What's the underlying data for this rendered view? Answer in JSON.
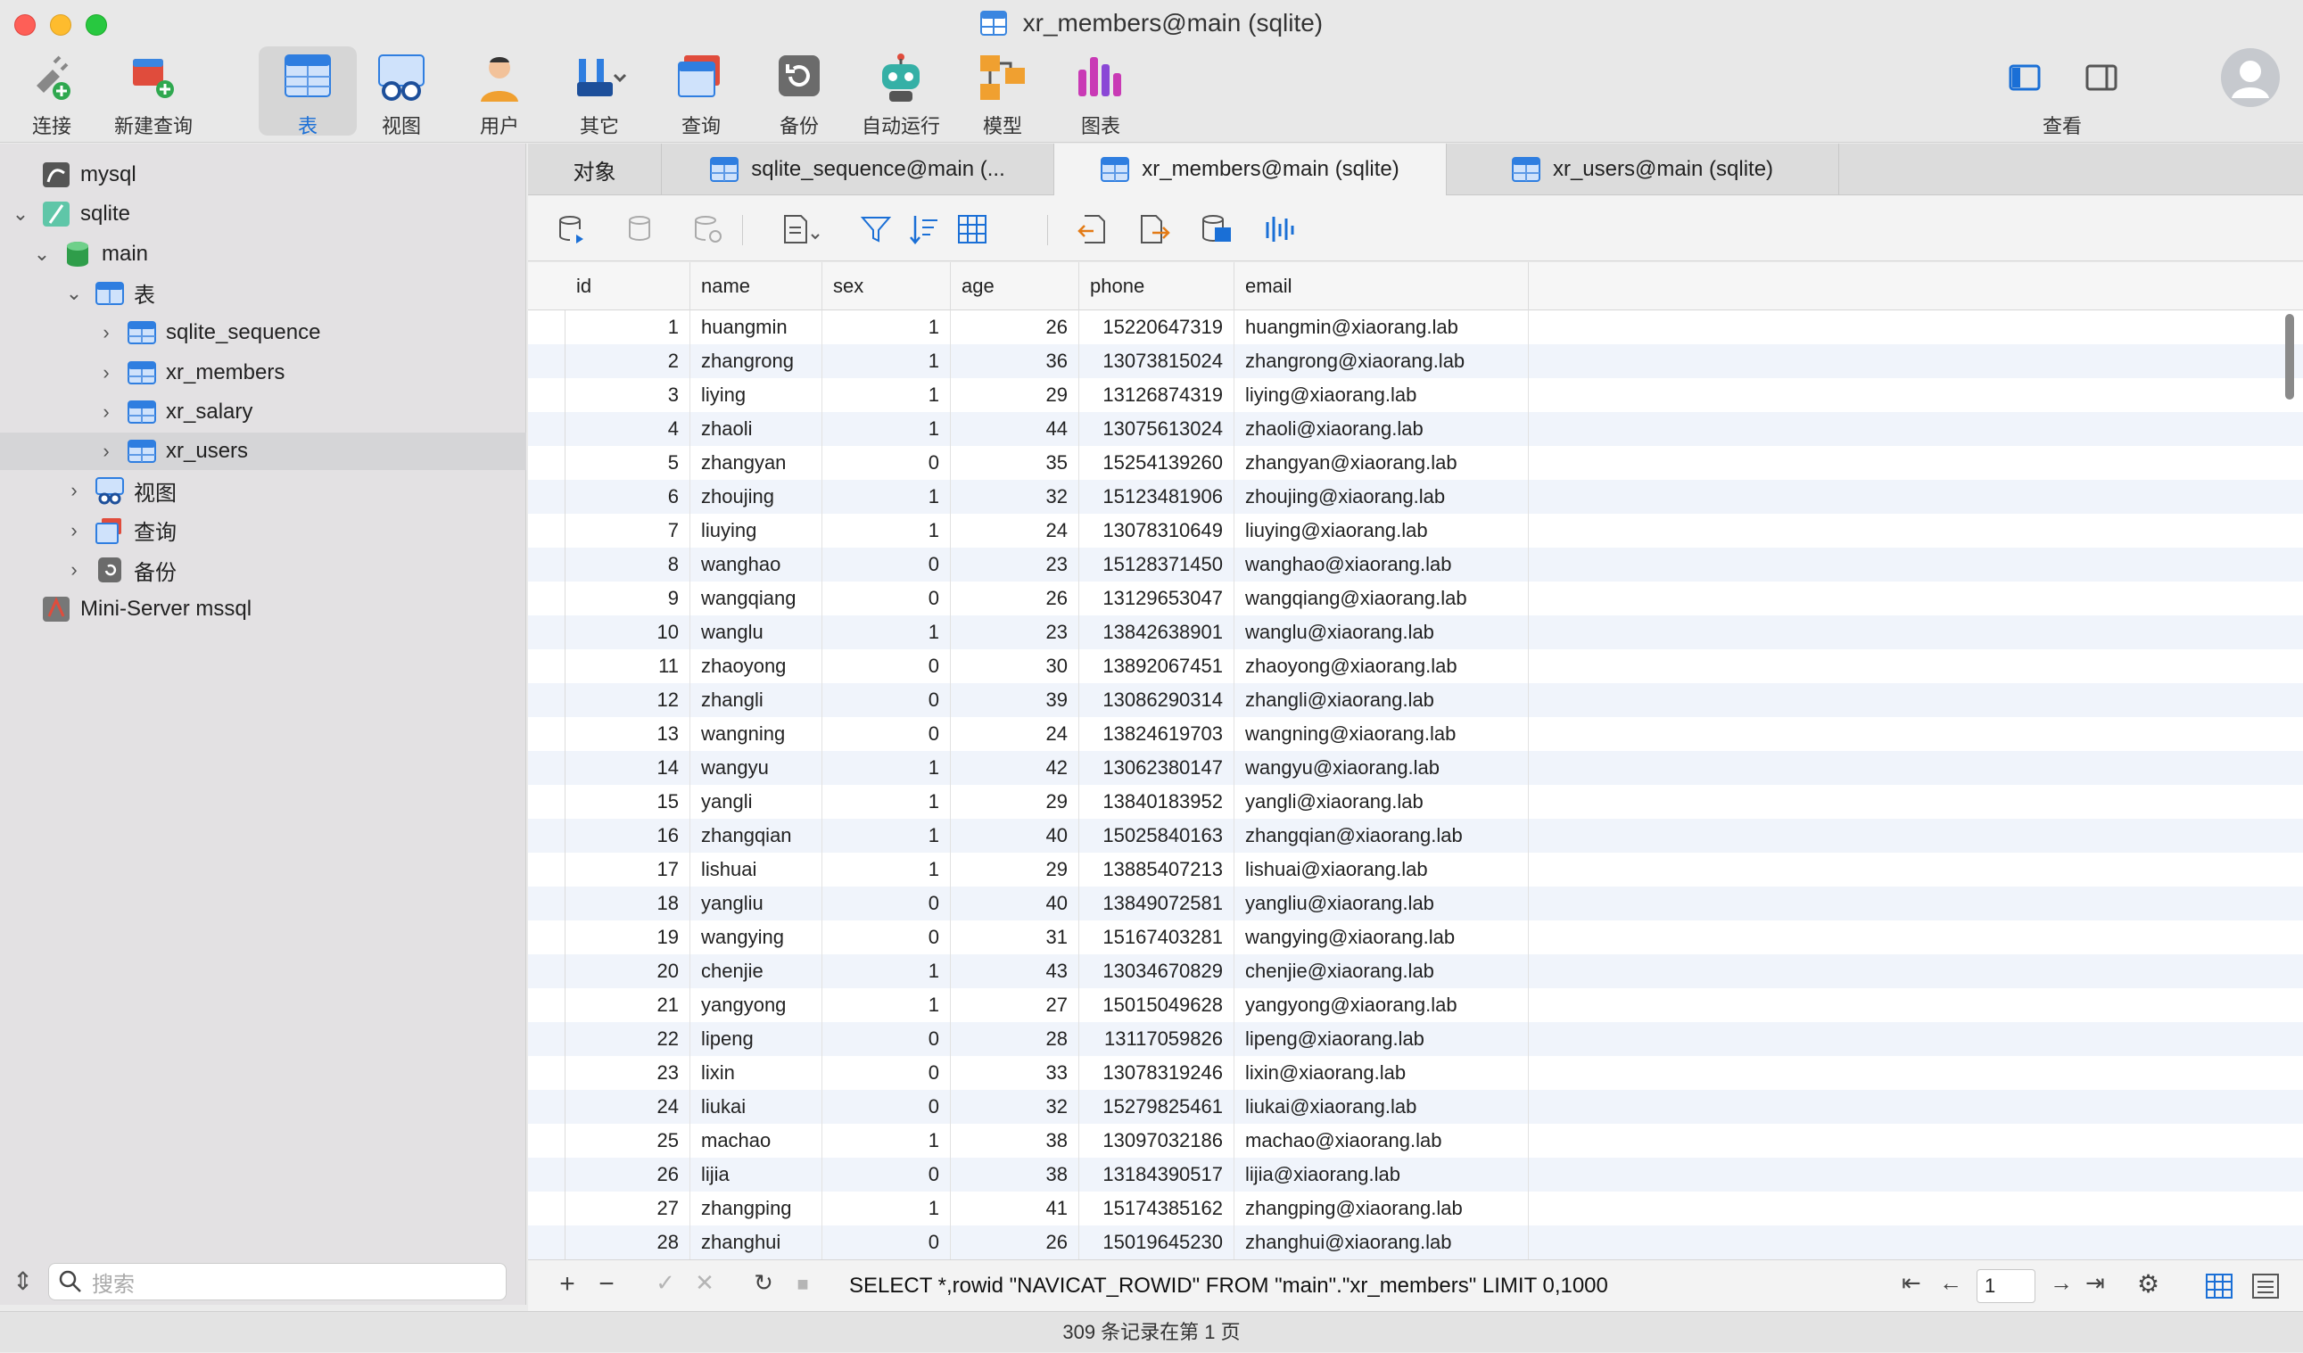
{
  "window": {
    "title": "xr_members@main (sqlite)"
  },
  "toolbar": {
    "items": [
      {
        "label": "连接",
        "icon": "connect-plug-icon"
      },
      {
        "label": "新建查询",
        "icon": "new-query-icon"
      },
      {
        "label": "表",
        "icon": "table-icon",
        "active": true
      },
      {
        "label": "视图",
        "icon": "view-glasses-icon"
      },
      {
        "label": "用户",
        "icon": "user-icon"
      },
      {
        "label": "其它",
        "icon": "tools-icon"
      },
      {
        "label": "查询",
        "icon": "query-icon"
      },
      {
        "label": "备份",
        "icon": "backup-icon"
      },
      {
        "label": "自动运行",
        "icon": "robot-icon"
      },
      {
        "label": "模型",
        "icon": "model-icon"
      },
      {
        "label": "图表",
        "icon": "chart-icon"
      }
    ],
    "view_label": "查看"
  },
  "sidebar": {
    "tree": [
      {
        "label": "mysql",
        "level": 0,
        "expanded": null,
        "icon": "mysql-icon"
      },
      {
        "label": "sqlite",
        "level": 0,
        "expanded": true,
        "icon": "sqlite-icon"
      },
      {
        "label": "main",
        "level": 1,
        "expanded": true,
        "icon": "database-icon"
      },
      {
        "label": "表",
        "level": 2,
        "expanded": true,
        "icon": "table-folder-icon"
      },
      {
        "label": "sqlite_sequence",
        "level": 3,
        "expanded": false,
        "icon": "table-icon"
      },
      {
        "label": "xr_members",
        "level": 3,
        "expanded": false,
        "icon": "table-icon"
      },
      {
        "label": "xr_salary",
        "level": 3,
        "expanded": false,
        "icon": "table-icon"
      },
      {
        "label": "xr_users",
        "level": 3,
        "expanded": false,
        "icon": "table-icon",
        "selected": true
      },
      {
        "label": "视图",
        "level": 2,
        "expanded": false,
        "icon": "view-folder-icon"
      },
      {
        "label": "查询",
        "level": 2,
        "expanded": false,
        "icon": "query-folder-icon"
      },
      {
        "label": "备份",
        "level": 2,
        "expanded": false,
        "icon": "backup-folder-icon"
      },
      {
        "label": "Mini-Server mssql",
        "level": 0,
        "expanded": null,
        "icon": "mssql-icon"
      }
    ],
    "search_placeholder": "搜索"
  },
  "tabs": [
    {
      "label": "对象",
      "active": false,
      "icon": ""
    },
    {
      "label": "sqlite_sequence@main (...",
      "active": false,
      "icon": "table-icon"
    },
    {
      "label": "xr_members@main (sqlite)",
      "active": true,
      "icon": "table-icon"
    },
    {
      "label": "xr_users@main (sqlite)",
      "active": false,
      "icon": "table-icon"
    }
  ],
  "grid": {
    "columns": [
      "id",
      "name",
      "sex",
      "age",
      "phone",
      "email"
    ],
    "rows": [
      [
        "1",
        "huangmin",
        "1",
        "26",
        "15220647319",
        "huangmin@xiaorang.lab"
      ],
      [
        "2",
        "zhangrong",
        "1",
        "36",
        "13073815024",
        "zhangrong@xiaorang.lab"
      ],
      [
        "3",
        "liying",
        "1",
        "29",
        "13126874319",
        "liying@xiaorang.lab"
      ],
      [
        "4",
        "zhaoli",
        "1",
        "44",
        "13075613024",
        "zhaoli@xiaorang.lab"
      ],
      [
        "5",
        "zhangyan",
        "0",
        "35",
        "15254139260",
        "zhangyan@xiaorang.lab"
      ],
      [
        "6",
        "zhoujing",
        "1",
        "32",
        "15123481906",
        "zhoujing@xiaorang.lab"
      ],
      [
        "7",
        "liuying",
        "1",
        "24",
        "13078310649",
        "liuying@xiaorang.lab"
      ],
      [
        "8",
        "wanghao",
        "0",
        "23",
        "15128371450",
        "wanghao@xiaorang.lab"
      ],
      [
        "9",
        "wangqiang",
        "0",
        "26",
        "13129653047",
        "wangqiang@xiaorang.lab"
      ],
      [
        "10",
        "wanglu",
        "1",
        "23",
        "13842638901",
        "wanglu@xiaorang.lab"
      ],
      [
        "11",
        "zhaoyong",
        "0",
        "30",
        "13892067451",
        "zhaoyong@xiaorang.lab"
      ],
      [
        "12",
        "zhangli",
        "0",
        "39",
        "13086290314",
        "zhangli@xiaorang.lab"
      ],
      [
        "13",
        "wangning",
        "0",
        "24",
        "13824619703",
        "wangning@xiaorang.lab"
      ],
      [
        "14",
        "wangyu",
        "1",
        "42",
        "13062380147",
        "wangyu@xiaorang.lab"
      ],
      [
        "15",
        "yangli",
        "1",
        "29",
        "13840183952",
        "yangli@xiaorang.lab"
      ],
      [
        "16",
        "zhangqian",
        "1",
        "40",
        "15025840163",
        "zhangqian@xiaorang.lab"
      ],
      [
        "17",
        "lishuai",
        "1",
        "29",
        "13885407213",
        "lishuai@xiaorang.lab"
      ],
      [
        "18",
        "yangliu",
        "0",
        "40",
        "13849072581",
        "yangliu@xiaorang.lab"
      ],
      [
        "19",
        "wangying",
        "0",
        "31",
        "15167403281",
        "wangying@xiaorang.lab"
      ],
      [
        "20",
        "chenjie",
        "1",
        "43",
        "13034670829",
        "chenjie@xiaorang.lab"
      ],
      [
        "21",
        "yangyong",
        "1",
        "27",
        "15015049628",
        "yangyong@xiaorang.lab"
      ],
      [
        "22",
        "lipeng",
        "0",
        "28",
        "13117059826",
        "lipeng@xiaorang.lab"
      ],
      [
        "23",
        "lixin",
        "0",
        "33",
        "13078319246",
        "lixin@xiaorang.lab"
      ],
      [
        "24",
        "liukai",
        "0",
        "32",
        "15279825461",
        "liukai@xiaorang.lab"
      ],
      [
        "25",
        "machao",
        "1",
        "38",
        "13097032186",
        "machao@xiaorang.lab"
      ],
      [
        "26",
        "lijia",
        "0",
        "38",
        "13184390517",
        "lijia@xiaorang.lab"
      ],
      [
        "27",
        "zhangping",
        "1",
        "41",
        "15174385162",
        "zhangping@xiaorang.lab"
      ],
      [
        "28",
        "zhanghui",
        "0",
        "26",
        "15019645230",
        "zhanghui@xiaorang.lab"
      ]
    ]
  },
  "bottombar": {
    "sql": "SELECT *,rowid \"NAVICAT_ROWID\" FROM \"main\".\"xr_members\" LIMIT 0,1000",
    "page": "1"
  },
  "status": "309 条记录在第 1 页",
  "colors": {
    "accent": "#1a6fd6",
    "selected_row": "#d5d5d7",
    "alt_row": "#f0f4fb"
  }
}
